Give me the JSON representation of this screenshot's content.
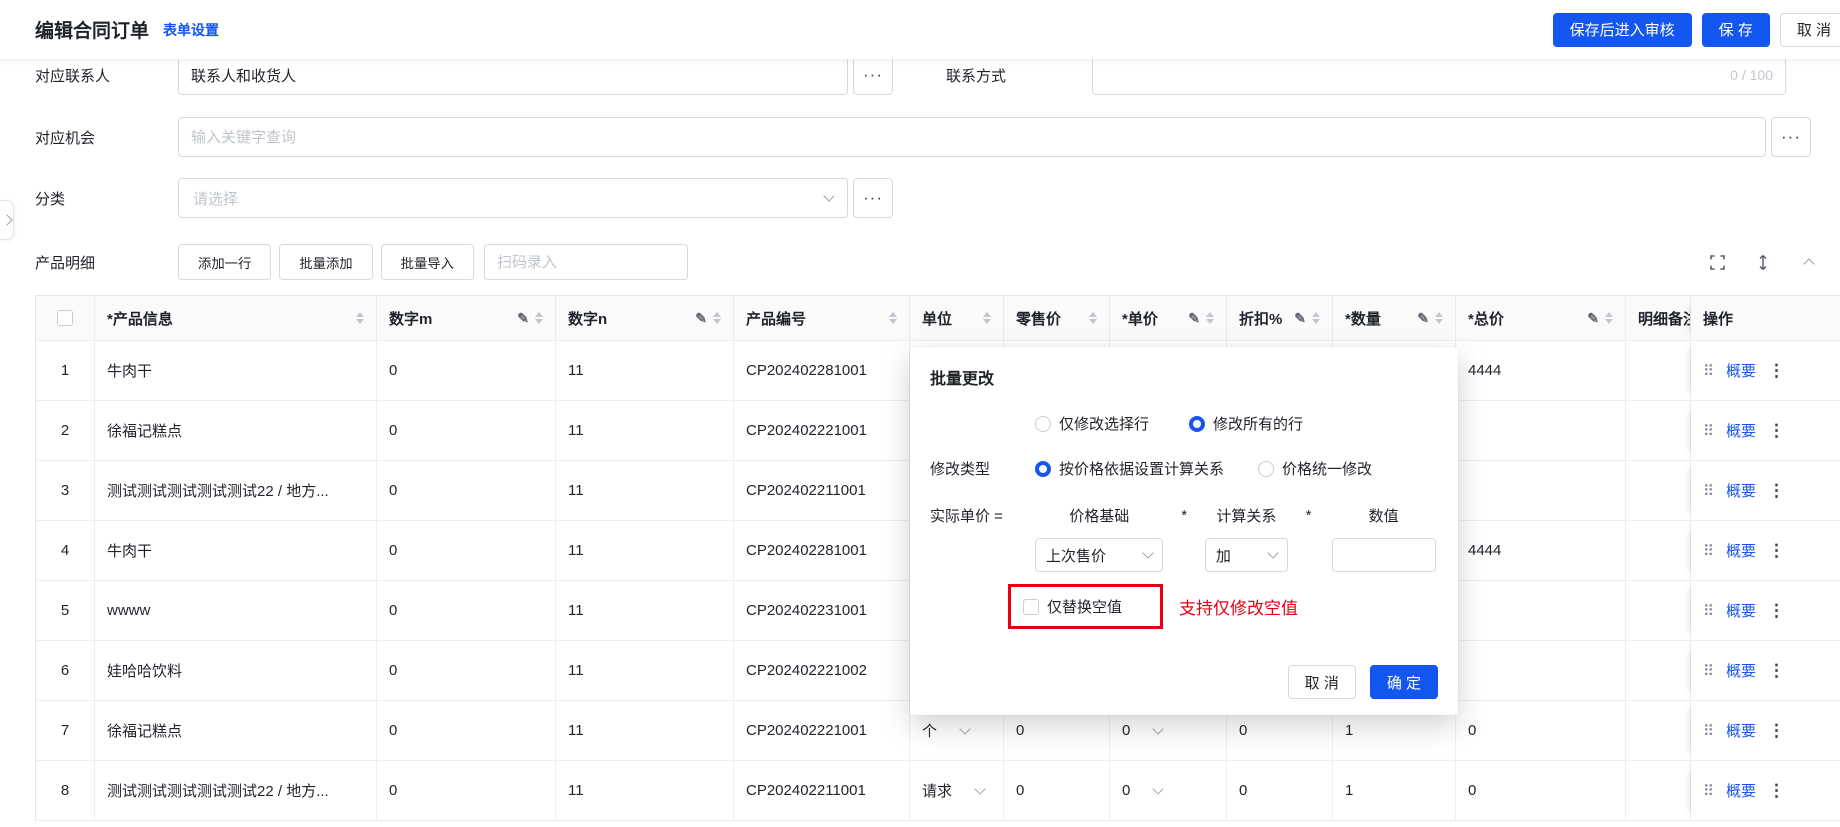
{
  "colors": {
    "primary": "#1456F0",
    "annotation_red": "#E60012"
  },
  "topbar": {
    "title": "编辑合同订单",
    "settings_link": "表单设置",
    "save_review_button": "保存后进入审核",
    "save_button": "保 存",
    "cancel_button": "取 消"
  },
  "form": {
    "contact_label": "对应联系人",
    "contact_value": "联系人和收货人",
    "contact_more": "···",
    "contact_method_label": "联系方式",
    "contact_method_counter": "0 / 100",
    "opportunity_label": "对应机会",
    "opportunity_placeholder": "输入关键字查询",
    "opportunity_more": "···",
    "category_label": "分类",
    "category_placeholder": "请选择",
    "category_more": "···"
  },
  "product_section": {
    "label": "产品明细",
    "add_row_button": "添加一行",
    "batch_add_button": "批量添加",
    "batch_import_button": "批量导入",
    "scan_input_placeholder": "扫码录入"
  },
  "table": {
    "columns": [
      {
        "label": "*产品信息"
      },
      {
        "label": "数字m"
      },
      {
        "label": "数字n"
      },
      {
        "label": "产品编号"
      },
      {
        "label": "单位"
      },
      {
        "label": "零售价"
      },
      {
        "label": "*单价"
      },
      {
        "label": "折扣%"
      },
      {
        "label": "*数量"
      },
      {
        "label": "*总价"
      },
      {
        "label": "明细备注"
      },
      {
        "label": "操作"
      }
    ],
    "summary_link": "概要",
    "rows": [
      {
        "no": "1",
        "product": "牛肉干",
        "m": "0",
        "n": "11",
        "code": "CP202402281001",
        "unit": "",
        "retail": "",
        "price": "",
        "discount": "",
        "qty": "",
        "total": "4444"
      },
      {
        "no": "2",
        "product": "徐福记糕点",
        "m": "0",
        "n": "11",
        "code": "CP202402221001",
        "unit": "",
        "retail": "",
        "price": "",
        "discount": "",
        "qty": "",
        "total": ""
      },
      {
        "no": "3",
        "product": "测试测试测试测试测试22 / 地方...",
        "m": "0",
        "n": "11",
        "code": "CP202402211001",
        "unit": "",
        "retail": "",
        "price": "",
        "discount": "",
        "qty": "",
        "total": ""
      },
      {
        "no": "4",
        "product": "牛肉干",
        "m": "0",
        "n": "11",
        "code": "CP202402281001",
        "unit": "",
        "retail": "",
        "price": "",
        "discount": "",
        "qty": "",
        "total": "4444"
      },
      {
        "no": "5",
        "product": "wwww",
        "m": "0",
        "n": "11",
        "code": "CP202402231001",
        "unit": "",
        "retail": "",
        "price": "",
        "discount": "",
        "qty": "",
        "total": ""
      },
      {
        "no": "6",
        "product": "娃哈哈饮料",
        "m": "0",
        "n": "11",
        "code": "CP202402221002",
        "unit": "",
        "retail": "",
        "price": "",
        "discount": "",
        "qty": "",
        "total": ""
      },
      {
        "no": "7",
        "product": "徐福记糕点",
        "m": "0",
        "n": "11",
        "code": "CP202402221001",
        "unit": "个",
        "retail": "0",
        "price": "0",
        "discount": "0",
        "qty": "1",
        "total": "0"
      },
      {
        "no": "8",
        "product": "测试测试测试测试测试22 / 地方...",
        "m": "0",
        "n": "11",
        "code": "CP202402211001",
        "unit": "请求",
        "retail": "0",
        "price": "0",
        "discount": "0",
        "qty": "1",
        "total": "0"
      }
    ]
  },
  "dialog": {
    "title": "批量更改",
    "scope_options": [
      {
        "label": "仅修改选择行",
        "checked": false
      },
      {
        "label": "修改所有的行",
        "checked": true
      }
    ],
    "modify_type_label": "修改类型",
    "modify_type_options": [
      {
        "label": "按价格依据设置计算关系",
        "checked": true
      },
      {
        "label": "价格统一修改",
        "checked": false
      }
    ],
    "formula_label": "实际单价 =",
    "formula_headers": [
      "价格基础",
      "*",
      "计算关系",
      "*",
      "数值"
    ],
    "price_basis_value": "上次售价",
    "relation_value": "加",
    "number_value": "",
    "replace_empty_label": "仅替换空值",
    "cancel_button": "取 消",
    "ok_button": "确 定"
  },
  "annotation": {
    "text": "支持仅修改空值"
  }
}
